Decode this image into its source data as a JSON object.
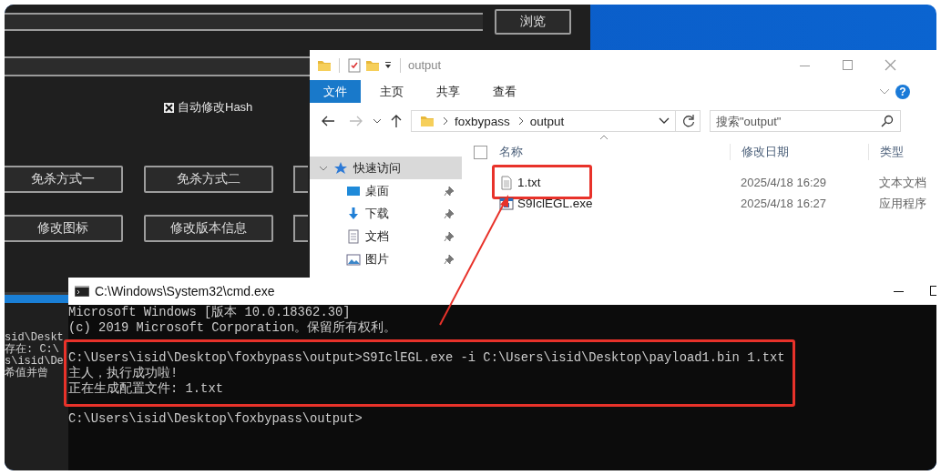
{
  "tool_window": {
    "browse_button": "浏览",
    "hash_checkbox": {
      "label": "自动修改Hash",
      "checked": true
    },
    "button_rows": [
      [
        "免杀方式一",
        "免杀方式二"
      ],
      [
        "修改图标",
        "修改版本信息"
      ]
    ],
    "log_lines": [
      "sid\\Deskt",
      "存在: C:\\",
      "s\\isid\\De",
      "希值并曾"
    ]
  },
  "explorer": {
    "title": "output",
    "ribbon_tabs": [
      {
        "label": "文件",
        "selected": true
      },
      {
        "label": "主页",
        "selected": false
      },
      {
        "label": "共享",
        "selected": false
      },
      {
        "label": "查看",
        "selected": false
      }
    ],
    "help": "?",
    "breadcrumb": [
      "foxbypass",
      "output"
    ],
    "search": {
      "placeholder": "搜索\"output\""
    },
    "nav_items": [
      {
        "label": "快速访问",
        "kind": "group",
        "selected": true,
        "pinned": false
      },
      {
        "label": "桌面",
        "kind": "desktop",
        "selected": false,
        "pinned": true
      },
      {
        "label": "下载",
        "kind": "download",
        "selected": false,
        "pinned": true
      },
      {
        "label": "文档",
        "kind": "document",
        "selected": false,
        "pinned": true
      },
      {
        "label": "图片",
        "kind": "pictures",
        "selected": false,
        "pinned": true
      }
    ],
    "select_all": {
      "checked": false
    },
    "columns": [
      "名称",
      "修改日期",
      "类型"
    ],
    "files": [
      {
        "name": "1.txt",
        "kind": "text",
        "modified": "2025/4/18 16:29",
        "type": "文本文档",
        "highlighted": true
      },
      {
        "name": "S9IclEGL.exe",
        "kind": "exe",
        "modified": "2025/4/18 16:27",
        "type": "应用程序",
        "highlighted": false
      }
    ]
  },
  "cmd": {
    "title": "C:\\Windows\\System32\\cmd.exe",
    "blocks": [
      {
        "highlighted": false,
        "lines": [
          "Microsoft Windows [版本 10.0.18362.30]",
          "(c) 2019 Microsoft Corporation。保留所有权利。"
        ]
      },
      {
        "highlighted": true,
        "lines": [
          "C:\\Users\\isid\\Desktop\\foxbypass\\output>S9IclEGL.exe -i C:\\Users\\isid\\Desktop\\payload1.bin 1.txt",
          "主人，执行成功啦!",
          "正在生成配置文件: 1.txt"
        ]
      },
      {
        "highlighted": false,
        "lines": [
          "C:\\Users\\isid\\Desktop\\foxbypass\\output>"
        ]
      }
    ]
  }
}
